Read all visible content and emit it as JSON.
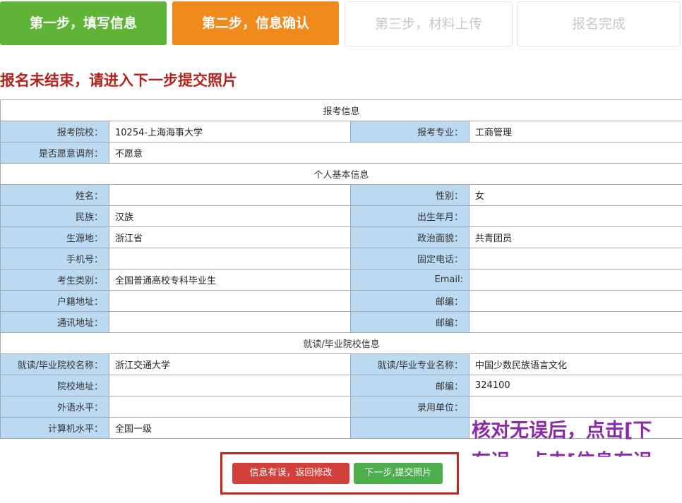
{
  "steps": [
    {
      "label": "第一步，填写信息",
      "state": "done"
    },
    {
      "label": "第二步，信息确认",
      "state": "current"
    },
    {
      "label": "第三步，材料上传",
      "state": "pending"
    },
    {
      "label": "报名完成",
      "state": "pending"
    }
  ],
  "notice": "报名未结束，请进入下一步提交照片",
  "sections": {
    "exam": "报考信息",
    "personal": "个人基本信息",
    "school": "就读/毕业院校信息"
  },
  "fields": {
    "school_applied_label": "报考院校：",
    "school_applied_value": "10254-上海海事大学",
    "major_label": "报考专业：",
    "major_value": "工商管理",
    "adjust_label": "是否愿意调剂：",
    "adjust_value": "不愿意",
    "name_label": "姓名：",
    "name_value": "",
    "gender_label": "性别：",
    "gender_value": "女",
    "ethnicity_label": "民族：",
    "ethnicity_value": "汉族",
    "birth_label": "出生年月：",
    "birth_value": "",
    "birthplace_label": "生源地：",
    "birthplace_value": "浙江省",
    "political_label": "政治面貌：",
    "political_value": "共青团员",
    "mobile_label": "手机号：",
    "mobile_value": "",
    "phone_label": "固定电话：",
    "phone_value": "",
    "type_label": "考生类别：",
    "type_value": "全国普通高校专科毕业生",
    "email_label": "Email:",
    "email_value": "",
    "address_label": "户籍地址：",
    "address_value": "",
    "zip1_label": "邮编：",
    "zip1_value": "",
    "mail_address_label": "通讯地址：",
    "mail_address_value": "",
    "zip2_label": "邮编：",
    "zip2_value": "",
    "grad_school_label": "就读/毕业院校名称：",
    "grad_school_value": "浙江交通大学",
    "grad_major_label": "就读/毕业专业名称：",
    "grad_major_value": "中国少数民族语言文化",
    "school_address_label": "院校地址：",
    "school_address_value": "",
    "zip3_label": "邮编：",
    "zip3_value": "324100",
    "english_label": "外语水平：",
    "english_value": "",
    "employer_label": "录用单位：",
    "employer_value": "",
    "computer_label": "计算机水平：",
    "computer_value": "全国一级"
  },
  "overlay": {
    "line1": "核对无误后，点击[下",
    "line2": "有误，点击[信息有误"
  },
  "buttons": {
    "back": "信息有误，返回修改",
    "next": "下一步,提交照片"
  },
  "colors": {
    "step_done": "#5fb336",
    "step_current": "#f08a1c",
    "notice": "#b4231d",
    "label_bg": "#bcd9f2",
    "back_button": "#d2403a",
    "next_button": "#4cae4c",
    "overlay_text": "#8b2aa8"
  }
}
